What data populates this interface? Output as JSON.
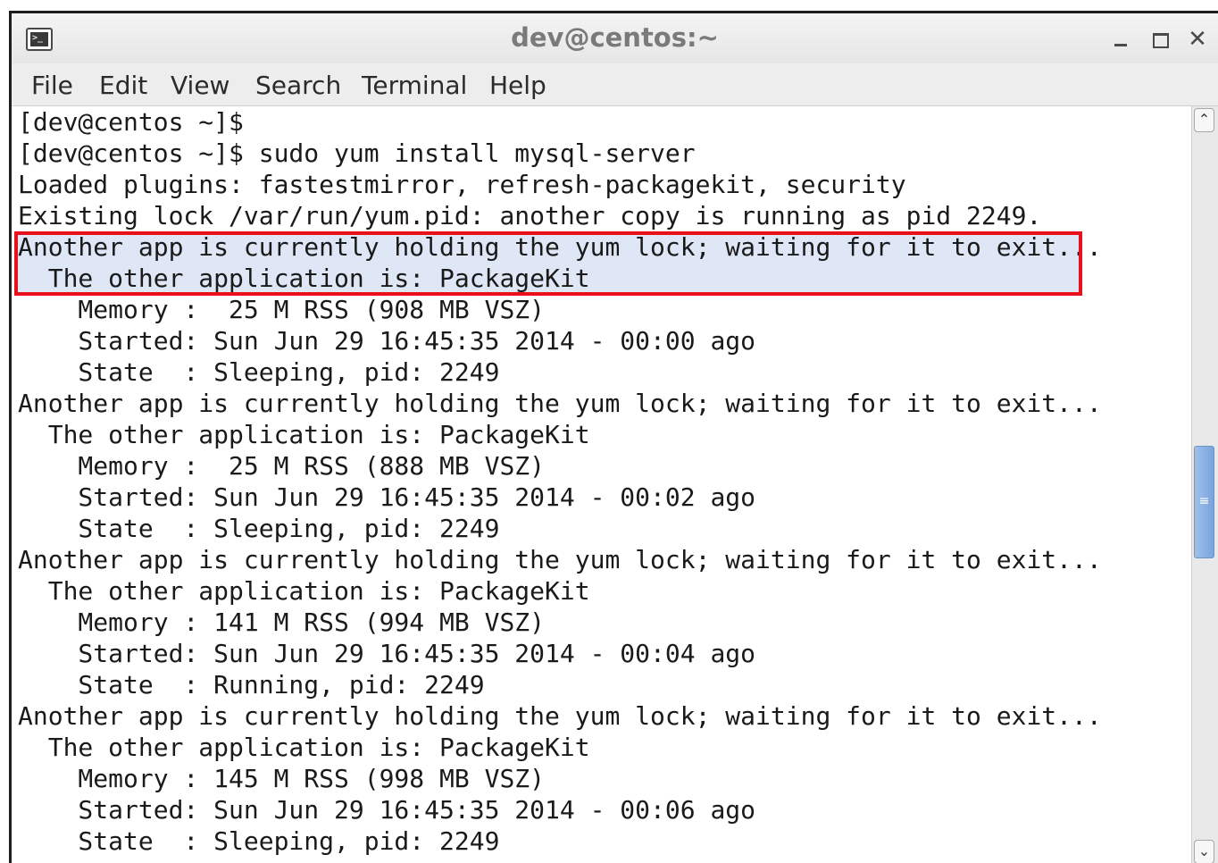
{
  "window": {
    "title": "dev@centos:~",
    "icons": {
      "app": "terminal-icon",
      "minimize": "minimize-icon",
      "maximize": "maximize-icon",
      "close": "close-icon"
    },
    "close_glyph": "✕"
  },
  "menu": [
    "File",
    "Edit",
    "View",
    "Search",
    "Terminal",
    "Help"
  ],
  "terminal": {
    "lines": [
      "[dev@centos ~]$",
      "[dev@centos ~]$ sudo yum install mysql-server",
      "Loaded plugins: fastestmirror, refresh-packagekit, security",
      "Existing lock /var/run/yum.pid: another copy is running as pid 2249.",
      "Another app is currently holding the yum lock; waiting for it to exit...",
      "  The other application is: PackageKit",
      "    Memory :  25 M RSS (908 MB VSZ)",
      "    Started: Sun Jun 29 16:45:35 2014 - 00:00 ago",
      "    State  : Sleeping, pid: 2249",
      "Another app is currently holding the yum lock; waiting for it to exit...",
      "  The other application is: PackageKit",
      "    Memory :  25 M RSS (888 MB VSZ)",
      "    Started: Sun Jun 29 16:45:35 2014 - 00:02 ago",
      "    State  : Sleeping, pid: 2249",
      "Another app is currently holding the yum lock; waiting for it to exit...",
      "  The other application is: PackageKit",
      "    Memory : 141 M RSS (994 MB VSZ)",
      "    Started: Sun Jun 29 16:45:35 2014 - 00:04 ago",
      "    State  : Running, pid: 2249",
      "Another app is currently holding the yum lock; waiting for it to exit...",
      "  The other application is: PackageKit",
      "    Memory : 145 M RSS (998 MB VSZ)",
      "    Started: Sun Jun 29 16:45:35 2014 - 00:06 ago",
      "    State  : Sleeping, pid: 2249"
    ],
    "highlight_color": "#e8101a",
    "selection_color": "#dfe6f5"
  },
  "scrollbar": {
    "up_glyph": "⌃",
    "down_glyph": "⌄",
    "thumb_glyph": "≡"
  }
}
